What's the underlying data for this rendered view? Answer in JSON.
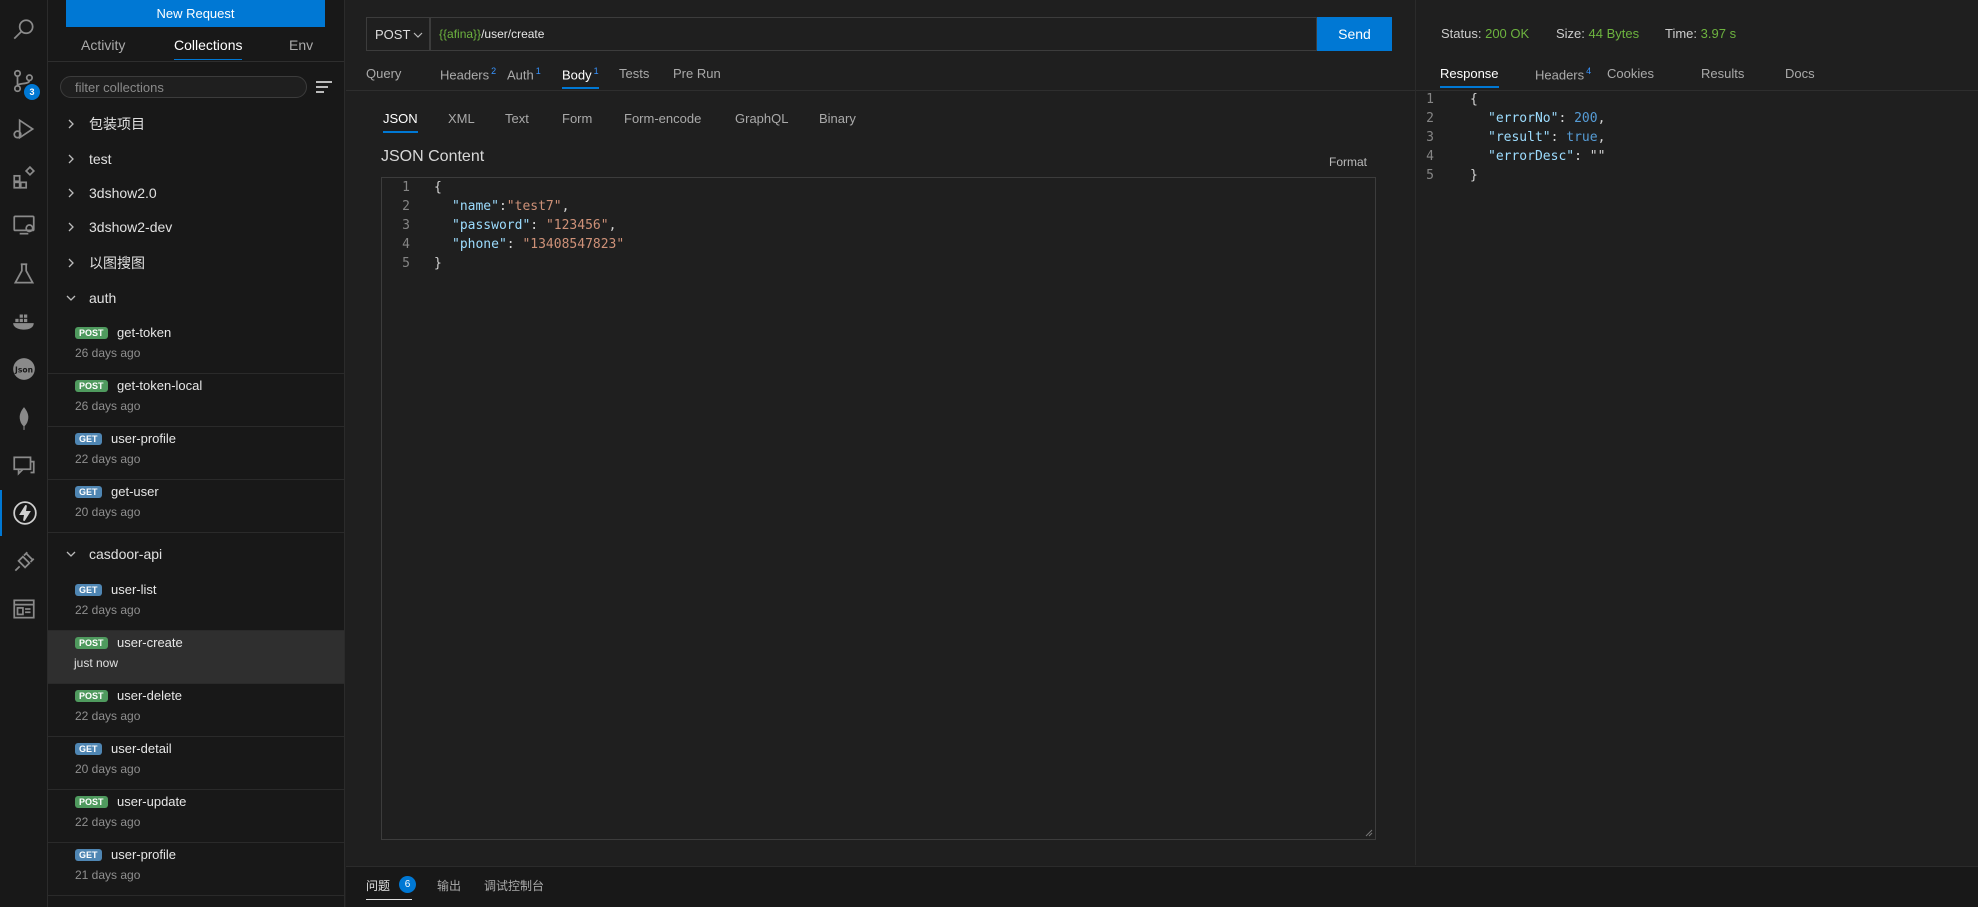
{
  "activity_bar": {
    "badge_count": "3"
  },
  "sidebar": {
    "new_request_label": "New Request",
    "tabs": [
      "Activity",
      "Collections",
      "Env"
    ],
    "filter_placeholder": "filter collections",
    "folders": [
      "包装项目",
      "test",
      "3dshow2.0",
      "3dshow2-dev",
      "以图搜图",
      "auth",
      "casdoor-api"
    ],
    "auth_requests": [
      {
        "method": "POST",
        "name": "get-token",
        "time": "26 days ago"
      },
      {
        "method": "POST",
        "name": "get-token-local",
        "time": "26 days ago"
      },
      {
        "method": "GET",
        "name": "user-profile",
        "time": "22 days ago"
      },
      {
        "method": "GET",
        "name": "get-user",
        "time": "20 days ago"
      }
    ],
    "casdoor_requests": [
      {
        "method": "GET",
        "name": "user-list",
        "time": "22 days ago"
      },
      {
        "method": "POST",
        "name": "user-create",
        "time": "just now"
      },
      {
        "method": "POST",
        "name": "user-delete",
        "time": "22 days ago"
      },
      {
        "method": "GET",
        "name": "user-detail",
        "time": "20 days ago"
      },
      {
        "method": "POST",
        "name": "user-update",
        "time": "22 days ago"
      },
      {
        "method": "GET",
        "name": "user-profile",
        "time": "21 days ago"
      }
    ]
  },
  "request": {
    "method": "POST",
    "url_var": "{{afina}}",
    "url_path": "/user/create",
    "send_label": "Send",
    "tabs": [
      {
        "label": "Query",
        "count": ""
      },
      {
        "label": "Headers",
        "count": "2"
      },
      {
        "label": "Auth",
        "count": "1"
      },
      {
        "label": "Body",
        "count": "1"
      },
      {
        "label": "Tests",
        "count": ""
      },
      {
        "label": "Pre Run",
        "count": ""
      }
    ],
    "body_tabs": [
      "JSON",
      "XML",
      "Text",
      "Form",
      "Form-encode",
      "GraphQL",
      "Binary"
    ],
    "content_label": "JSON Content",
    "format_label": "Format",
    "line_numbers": [
      "1",
      "2",
      "3",
      "4",
      "5"
    ],
    "body_lines": [
      {
        "p1": "{"
      },
      {
        "k": "\"name\"",
        "sep": ":",
        "v": "\"test7\"",
        "end": ","
      },
      {
        "k": "\"password\"",
        "sep": ": ",
        "v": "\"123456\"",
        "end": ","
      },
      {
        "k": "\"phone\"",
        "sep": ": ",
        "v": "\"13408547823\"",
        "end": ""
      },
      {
        "p1": "}"
      }
    ]
  },
  "response": {
    "status_label": "Status:",
    "status_value": "200 OK",
    "size_label": "Size:",
    "size_value": "44 Bytes",
    "time_label": "Time:",
    "time_value": "3.97 s",
    "tabs": [
      {
        "label": "Response",
        "count": ""
      },
      {
        "label": "Headers",
        "count": "4"
      },
      {
        "label": "Cookies",
        "count": ""
      },
      {
        "label": "Results",
        "count": ""
      },
      {
        "label": "Docs",
        "count": ""
      }
    ],
    "line_numbers": [
      "1",
      "2",
      "3",
      "4",
      "5"
    ],
    "body": {
      "l1": "{",
      "k2": "\"errorNo\"",
      "v2": "200",
      "k3": "\"result\"",
      "v3": "true",
      "k4": "\"errorDesc\"",
      "v4": "\"\"",
      "l5": "}"
    }
  },
  "bottom_panel": {
    "tabs": [
      "问题",
      "输出",
      "调试控制台"
    ],
    "problems_count": "6"
  },
  "colors": {
    "accent": "#0078d4",
    "post": "#4f9a5e",
    "get": "#4f86b3",
    "status_ok": "#6db33f"
  }
}
